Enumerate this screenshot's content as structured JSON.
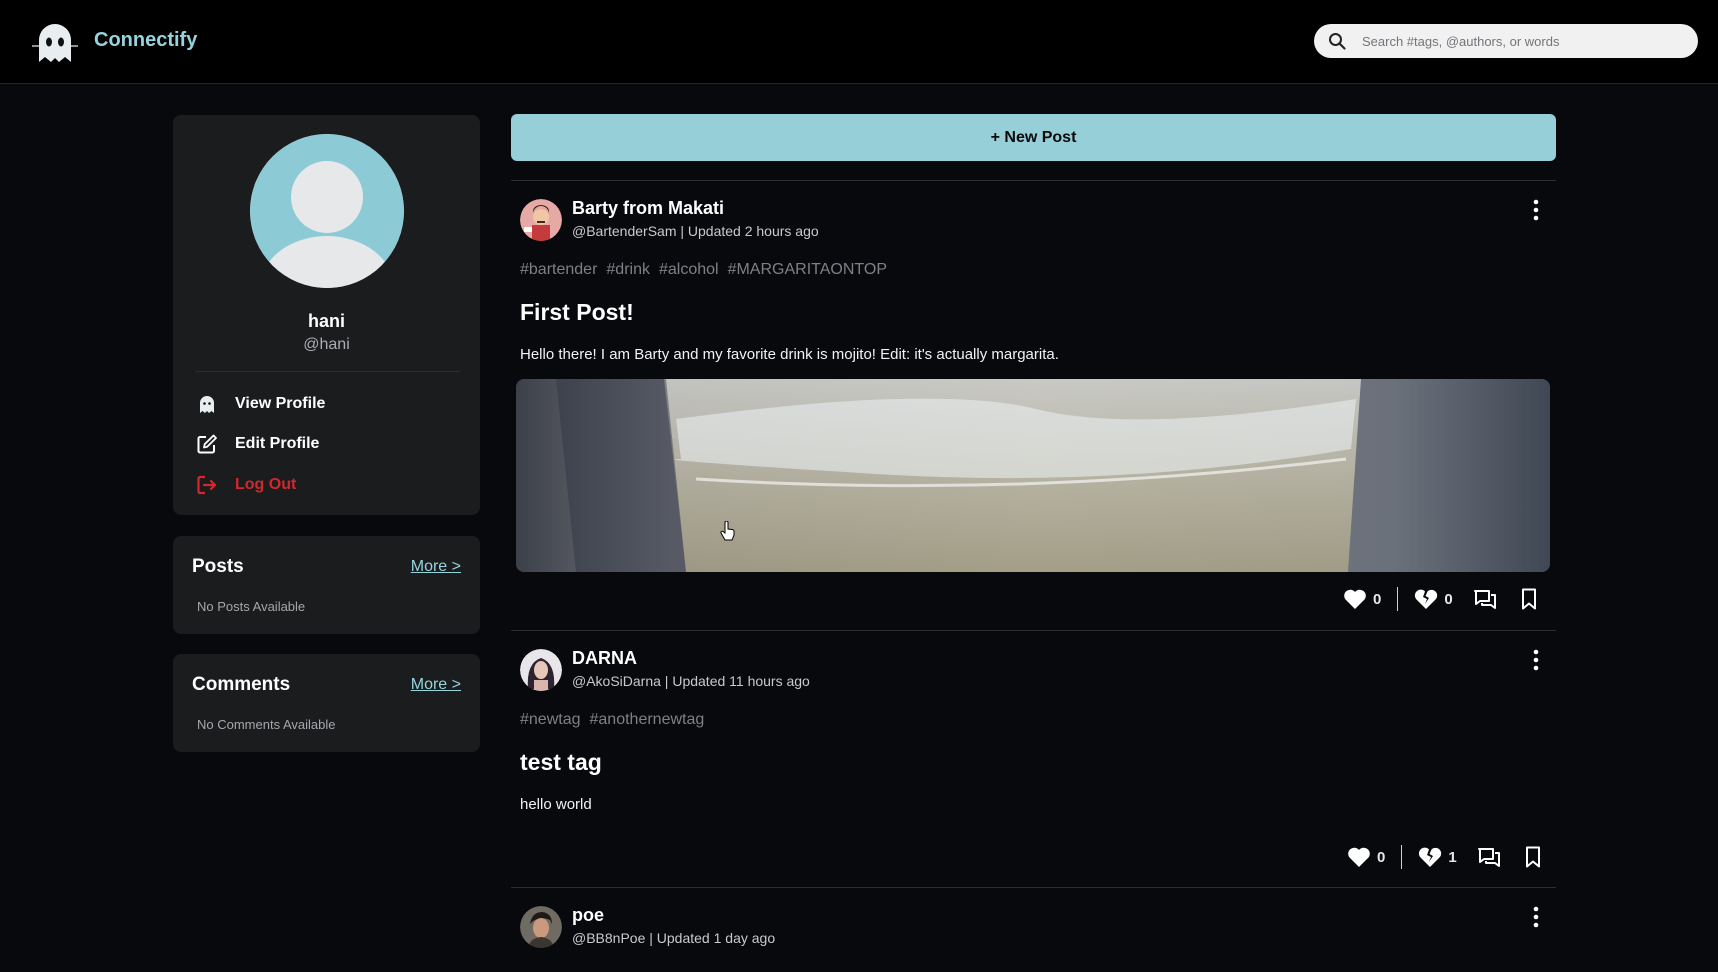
{
  "app": {
    "name": "Connectify"
  },
  "search": {
    "placeholder": "Search #tags, @authors, or words",
    "value": ""
  },
  "profile": {
    "name": "hani",
    "handle": "@hani",
    "menu": {
      "view": "View Profile",
      "edit": "Edit Profile",
      "logout": "Log Out"
    }
  },
  "posts_card": {
    "title": "Posts",
    "more": "More >",
    "empty": "No Posts Available"
  },
  "comments_card": {
    "title": "Comments",
    "more": "More >",
    "empty": "No Comments Available"
  },
  "new_post_label": "+ New Post",
  "colors": {
    "accent": "#96cfd8",
    "danger": "#d6262b",
    "bg": "#07090c",
    "card": "#1b1c1e"
  },
  "feed": [
    {
      "author": "Barty from Makati",
      "meta": "@BartenderSam | Updated 2 hours ago",
      "tags": [
        "#bartender",
        "#drink",
        "#alcohol",
        "#MARGARITAONTOP"
      ],
      "title": "First Post!",
      "body": "Hello there! I am Barty and my favorite drink is mojito! Edit: it's actually margarita.",
      "likes": "0",
      "dislikes": "0"
    },
    {
      "author": "DARNA",
      "meta": "@AkoSiDarna | Updated 11 hours ago",
      "tags": [
        "#newtag",
        "#anothernewtag"
      ],
      "title": "test tag",
      "body": "hello world",
      "likes": "0",
      "dislikes": "1"
    },
    {
      "author": "poe",
      "meta": "@BB8nPoe | Updated 1 day ago"
    }
  ],
  "icons": {
    "logo": "ghost-logo-icon",
    "search": "search-icon",
    "view_profile": "ghost-icon",
    "edit_profile": "edit-icon",
    "logout": "logout-icon",
    "like": "heart-icon",
    "dislike": "broken-heart-icon",
    "comment": "comment-icon",
    "bookmark": "bookmark-icon",
    "more": "kebab-menu-icon"
  }
}
